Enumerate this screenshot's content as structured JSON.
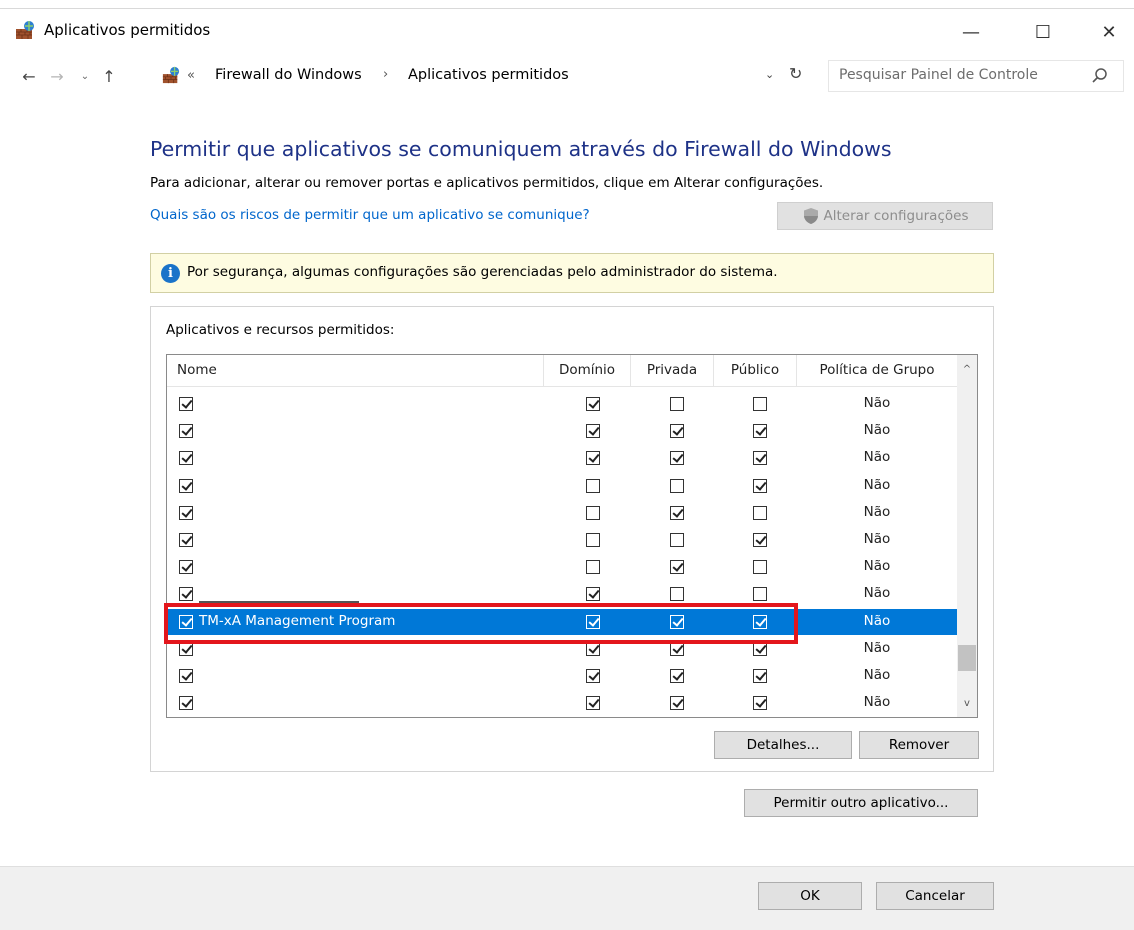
{
  "window": {
    "title": "Aplicativos permitidos",
    "controls": {
      "minimize": "—",
      "maximize": "☐",
      "close": "✕"
    }
  },
  "nav": {
    "back": "←",
    "forward": "→",
    "recent": "⌄",
    "up": "↑",
    "more": "«",
    "breadcrumbs": [
      "Firewall do Windows",
      "Aplicativos permitidos"
    ],
    "separator": "›",
    "dropdown": "⌄",
    "refresh": "↻",
    "search_placeholder": "Pesquisar Painel de Controle"
  },
  "content": {
    "heading": "Permitir que aplicativos se comuniquem através do Firewall do Windows",
    "description": "Para adicionar, alterar ou remover portas e aplicativos permitidos, clique em Alterar configurações.",
    "risk_link": "Quais são os riscos de permitir que um aplicativo se comunique?",
    "change_settings": "Alterar configurações",
    "info": "Por segurança, algumas configurações são gerenciadas pelo administrador do sistema.",
    "info_glyph": "i"
  },
  "list": {
    "group_label": "Aplicativos e recursos permitidos:",
    "columns": {
      "name": "Nome",
      "domain": "Domínio",
      "private": "Privada",
      "public": "Público",
      "group_policy": "Política de Grupo"
    },
    "rows": [
      {
        "name": "",
        "enabled": true,
        "domain": true,
        "private": false,
        "public": false,
        "group_policy": "Não",
        "selected": false
      },
      {
        "name": "",
        "enabled": true,
        "domain": true,
        "private": true,
        "public": true,
        "group_policy": "Não",
        "selected": false
      },
      {
        "name": "",
        "enabled": true,
        "domain": true,
        "private": true,
        "public": true,
        "group_policy": "Não",
        "selected": false
      },
      {
        "name": "",
        "enabled": true,
        "domain": false,
        "private": false,
        "public": true,
        "group_policy": "Não",
        "selected": false
      },
      {
        "name": "",
        "enabled": true,
        "domain": false,
        "private": true,
        "public": false,
        "group_policy": "Não",
        "selected": false
      },
      {
        "name": "",
        "enabled": true,
        "domain": false,
        "private": false,
        "public": true,
        "group_policy": "Não",
        "selected": false
      },
      {
        "name": "",
        "enabled": true,
        "domain": false,
        "private": true,
        "public": false,
        "group_policy": "Não",
        "selected": false
      },
      {
        "name": "",
        "enabled": true,
        "domain": true,
        "private": false,
        "public": false,
        "group_policy": "Não",
        "selected": false
      },
      {
        "name": "TM-xA Management Program",
        "enabled": true,
        "domain": true,
        "private": true,
        "public": true,
        "group_policy": "Não",
        "selected": true
      },
      {
        "name": "",
        "enabled": true,
        "domain": true,
        "private": true,
        "public": true,
        "group_policy": "Não",
        "selected": false
      },
      {
        "name": "",
        "enabled": true,
        "domain": true,
        "private": true,
        "public": true,
        "group_policy": "Não",
        "selected": false
      },
      {
        "name": "",
        "enabled": true,
        "domain": true,
        "private": true,
        "public": true,
        "group_policy": "Não",
        "selected": false
      }
    ],
    "scroll_up": "^",
    "scroll_down": "v"
  },
  "buttons": {
    "details": "Detalhes...",
    "remove": "Remover",
    "allow_other": "Permitir outro aplicativo...",
    "ok": "OK",
    "cancel": "Cancelar"
  },
  "colors": {
    "heading": "#1e3287",
    "link": "#0066cc",
    "selection": "#0078d7",
    "highlight_border": "#e3161c",
    "info_background": "#fefce1"
  }
}
